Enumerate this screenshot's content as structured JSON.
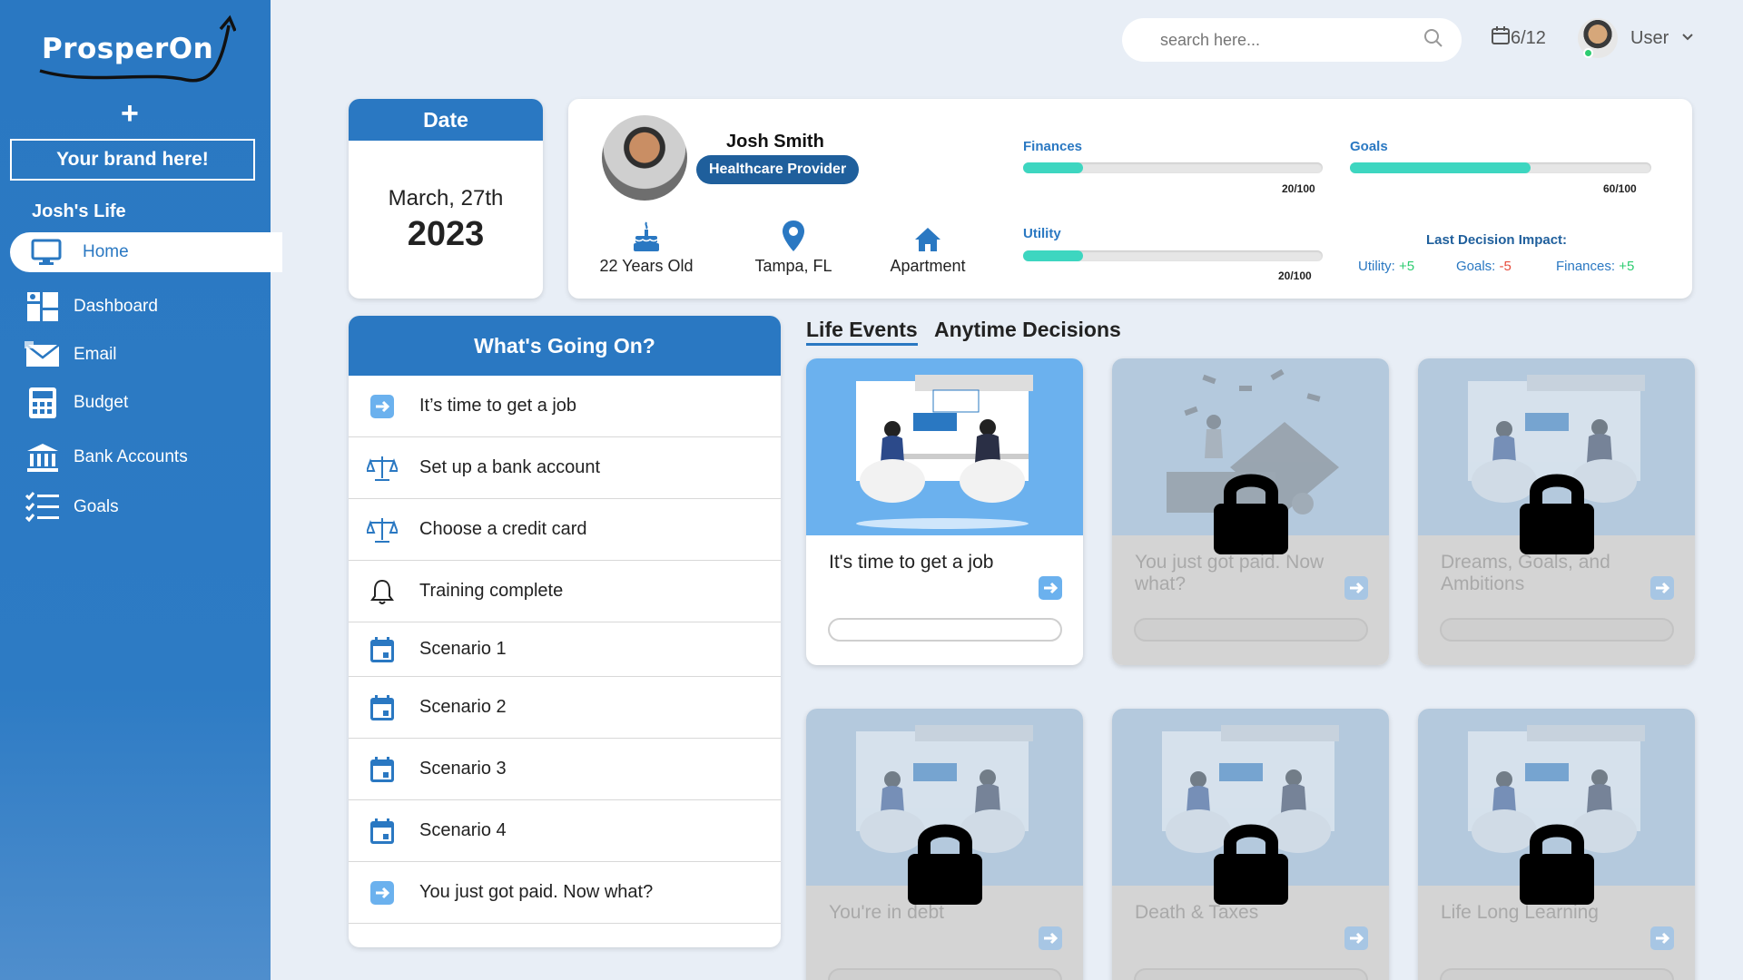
{
  "sidebar": {
    "logo_text": "ProsperOn",
    "add_symbol": "+",
    "brand_label": "Your brand here!",
    "section_title": "Josh's Life",
    "items": [
      {
        "label": "Home",
        "icon": "monitor-icon"
      },
      {
        "label": "Dashboard",
        "icon": "dashboard-icon"
      },
      {
        "label": "Email",
        "icon": "email-icon"
      },
      {
        "label": "Budget",
        "icon": "calculator-icon"
      },
      {
        "label": "Bank Accounts",
        "icon": "bank-icon"
      },
      {
        "label": "Goals",
        "icon": "checklist-icon"
      }
    ]
  },
  "header": {
    "search_placeholder": "search here...",
    "date_short": "6/12",
    "user_label": "User"
  },
  "date_card": {
    "title": "Date",
    "month_day": "March, 27th",
    "year": "2023"
  },
  "profile": {
    "name": "Josh Smith",
    "role": "Healthcare Provider",
    "age": "22 Years Old",
    "location": "Tampa, FL",
    "housing": "Apartment",
    "metrics": [
      {
        "label": "Finances",
        "value": 20,
        "max": 100,
        "text": "20/100"
      },
      {
        "label": "Goals",
        "value": 60,
        "max": 100,
        "text": "60/100"
      },
      {
        "label": "Utility",
        "value": 20,
        "max": 100,
        "text": "20/100"
      }
    ],
    "impact_title": "Last Decision Impact:",
    "impact": [
      {
        "label": "Utility:",
        "value": "+5"
      },
      {
        "label": "Goals:",
        "value": "-5"
      },
      {
        "label": "Finances:",
        "value": "+5"
      }
    ]
  },
  "going_on": {
    "title": "What's Going On?",
    "items": [
      {
        "label": "It’s time to get a job",
        "icon": "arrow-right-icon"
      },
      {
        "label": "Set up a bank account",
        "icon": "scales-icon"
      },
      {
        "label": "Choose a credit card",
        "icon": "scales-icon"
      },
      {
        "label": "Training complete",
        "icon": "bell-icon"
      },
      {
        "label": "Scenario 1",
        "icon": "calendar-icon"
      },
      {
        "label": "Scenario 2",
        "icon": "calendar-icon"
      },
      {
        "label": "Scenario 3",
        "icon": "calendar-icon"
      },
      {
        "label": "Scenario 4",
        "icon": "calendar-icon"
      },
      {
        "label": "You just got paid. Now what?",
        "icon": "arrow-right-icon"
      }
    ]
  },
  "tabs": {
    "life_events": "Life Events",
    "anytime_decisions": "Anytime Decisions"
  },
  "events": [
    {
      "title": "It's time to get a job",
      "locked": false
    },
    {
      "title": "You just got paid. Now what?",
      "locked": true
    },
    {
      "title": "Dreams, Goals, and Ambitions",
      "locked": true
    },
    {
      "title": "You're in debt",
      "locked": true
    },
    {
      "title": "Death & Taxes",
      "locked": true
    },
    {
      "title": "Life Long Learning",
      "locked": true
    }
  ],
  "colors": {
    "primary": "#2a78c2",
    "progress": "#3dd6c0",
    "positive": "#2ecc71",
    "negative": "#e74c3c"
  }
}
